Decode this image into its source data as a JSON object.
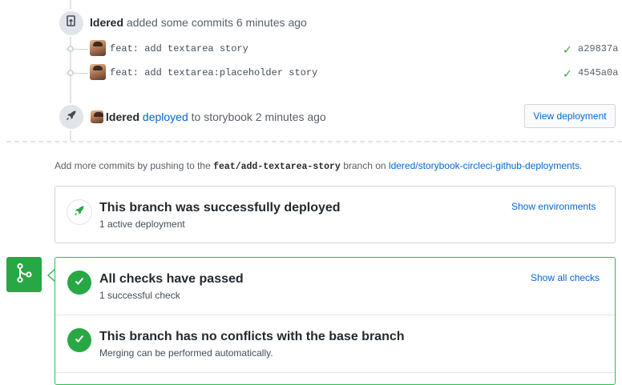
{
  "timeline": {
    "commits_event": {
      "user": "ldered",
      "action": "added some commits",
      "time": "6 minutes ago"
    },
    "commits": [
      {
        "message": "feat: add textarea story",
        "sha": "a29837a"
      },
      {
        "message": "feat: add textarea:placeholder story",
        "sha": "4545a0a"
      }
    ],
    "deploy_event": {
      "user": "ldered",
      "action_link": "deployed",
      "rest": "to storybook 2 minutes ago",
      "button": "View deployment"
    }
  },
  "note": {
    "prefix": "Add more commits by pushing to the",
    "branch": "feat/add-textarea-story",
    "middle": "branch on",
    "repo": "ldered/storybook-circleci-github-deployments",
    "suffix": "."
  },
  "deployment": {
    "title": "This branch was successfully deployed",
    "subtitle": "1 active deployment",
    "link": "Show environments"
  },
  "merge": {
    "checks": {
      "title": "All checks have passed",
      "subtitle": "1 successful check",
      "link": "Show all checks"
    },
    "conflicts": {
      "title": "This branch has no conflicts with the base branch",
      "subtitle": "Merging can be performed automatically."
    }
  },
  "colors": {
    "success": "#28a745",
    "link": "#0366d6"
  }
}
